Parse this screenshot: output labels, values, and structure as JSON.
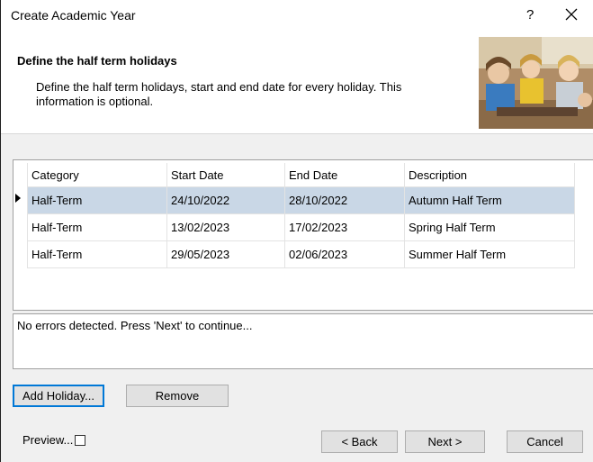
{
  "window": {
    "title": "Create Academic Year",
    "help_label": "?"
  },
  "header": {
    "title": "Define the half term holidays",
    "description": "Define the half term holidays, start and end date for every holiday. This information is optional."
  },
  "grid": {
    "columns": [
      "Category",
      "Start Date",
      "End Date",
      "Description"
    ],
    "rows": [
      {
        "category": "Half-Term",
        "start": "24/10/2022",
        "end": "28/10/2022",
        "description": "Autumn Half Term"
      },
      {
        "category": "Half-Term",
        "start": "13/02/2023",
        "end": "17/02/2023",
        "description": "Spring Half Term"
      },
      {
        "category": "Half-Term",
        "start": "29/05/2023",
        "end": "02/06/2023",
        "description": "Summer Half Term"
      }
    ]
  },
  "status": {
    "message": "No errors detected. Press 'Next' to continue..."
  },
  "buttons": {
    "add_holiday": "Add Holiday...",
    "remove": "Remove",
    "back": "< Back",
    "next": "Next >",
    "cancel": "Cancel"
  },
  "preview": {
    "label": "Preview...",
    "checked": false
  },
  "colors": {
    "selected_row": "#c9d7e6",
    "default_button_border": "#0078d7"
  }
}
